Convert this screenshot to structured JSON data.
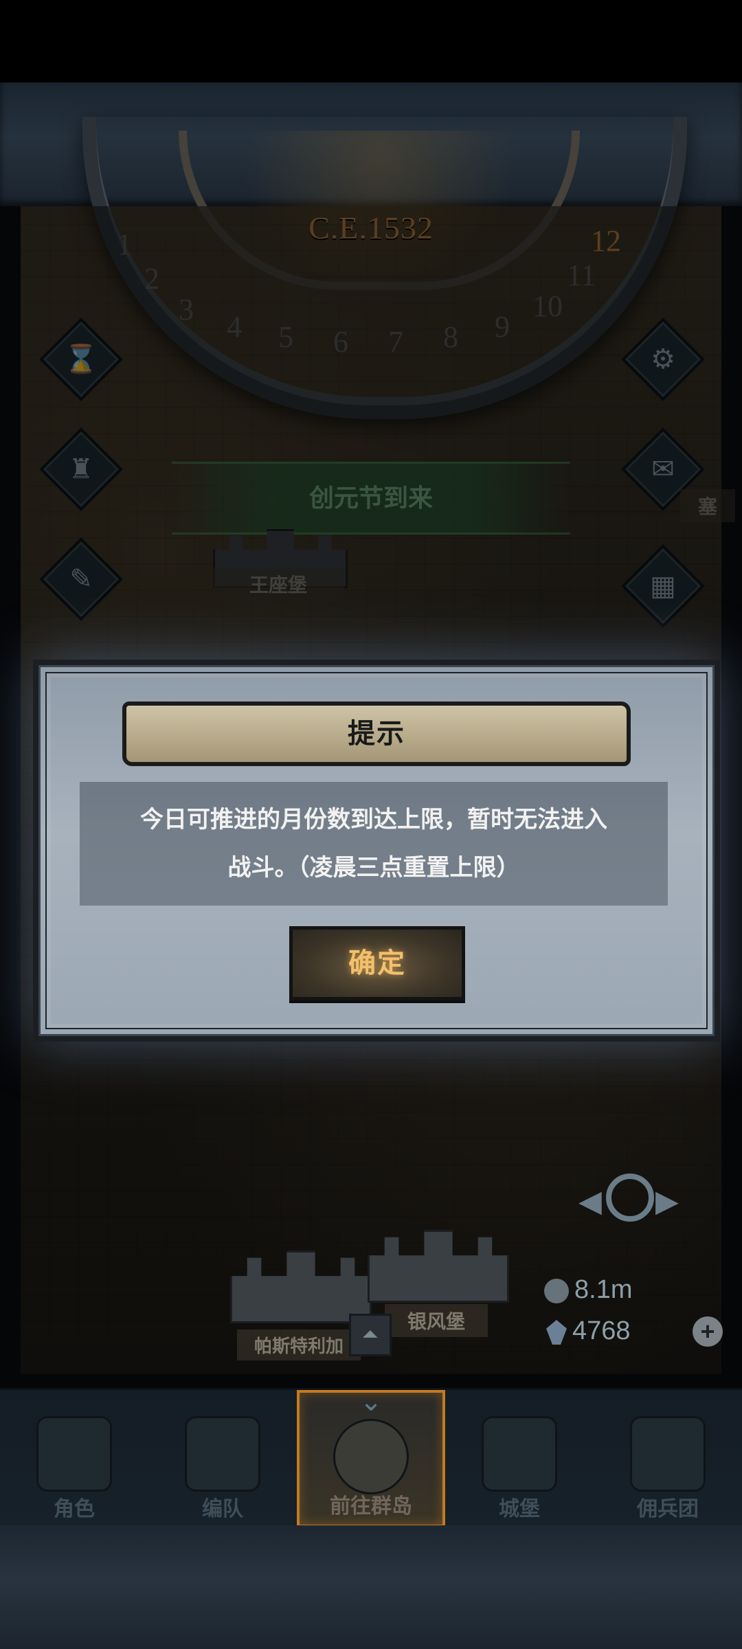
{
  "map": {
    "year": "C.E.1532",
    "months": [
      "1",
      "2",
      "3",
      "4",
      "5",
      "6",
      "7",
      "8",
      "9",
      "10",
      "11",
      "12"
    ],
    "event_banner": "创元节到来",
    "places": [
      {
        "name": "王座堡"
      },
      {
        "name": "银风堡"
      },
      {
        "name": "帕斯特利加"
      },
      {
        "name": "塞"
      }
    ],
    "side_icons": [
      "hourglass-icon",
      "bag-icon",
      "scroll-icon",
      "gear-icon",
      "mail-icon",
      "castle-grid-icon"
    ],
    "resources": {
      "silver": "8.1m",
      "gems": "4768"
    }
  },
  "dialog": {
    "title": "提示",
    "message_line1": "今日可推进的月份数到达上限，暂时无法进入",
    "message_line2": "战斗。（凌晨三点重置上限）",
    "confirm": "确定"
  },
  "nav": {
    "items": [
      {
        "label": "角色",
        "icon": "knight-icon"
      },
      {
        "label": "编队",
        "icon": "helmet-icon"
      },
      {
        "label": "前往群岛",
        "icon": "globe-icon",
        "active": true
      },
      {
        "label": "城堡",
        "icon": "castle-icon"
      },
      {
        "label": "佣兵团",
        "icon": "mercenary-icon"
      }
    ]
  },
  "colors": {
    "accent": "#c27b1f",
    "confirm_text": "#f3c06c",
    "event_text": "#6ea57c"
  }
}
